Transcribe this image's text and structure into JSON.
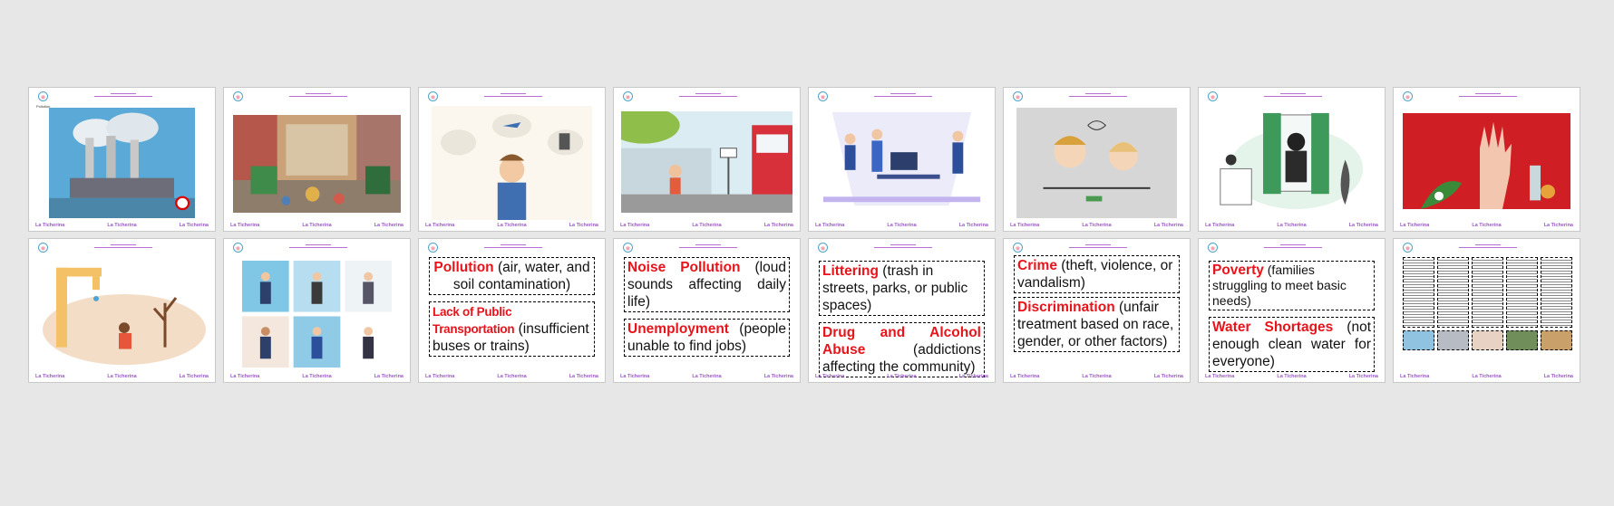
{
  "footer": {
    "brand": "La Ticherina"
  },
  "slides": [
    {
      "type": "image",
      "icon": "factory-pollution-illustration",
      "label": "Pollution"
    },
    {
      "type": "image",
      "icon": "littered-street-illustration"
    },
    {
      "type": "image",
      "icon": "noise-stress-illustration"
    },
    {
      "type": "image",
      "icon": "missed-bus-illustration"
    },
    {
      "type": "image",
      "icon": "office-unemployment-illustration"
    },
    {
      "type": "image",
      "icon": "stressed-people-illustration"
    },
    {
      "type": "image",
      "icon": "burglar-window-illustration"
    },
    {
      "type": "image",
      "icon": "drugs-alcohol-hand-illustration"
    },
    {
      "type": "image",
      "icon": "dry-tap-drought-illustration"
    },
    {
      "type": "image",
      "icon": "discrimination-grid-illustration"
    },
    {
      "type": "text",
      "boxes": [
        {
          "keyword": "Pollution",
          "text": " (air, water, and soil contamination)"
        },
        {
          "keyword": "Lack of Public Transportation",
          "text": " (insufficient buses or trains)"
        }
      ]
    },
    {
      "type": "text",
      "boxes": [
        {
          "keyword": "Noise Pollution",
          "text": " (loud sounds affecting daily life)"
        },
        {
          "keyword": "Unemployment",
          "text": " (people unable to find jobs)"
        }
      ]
    },
    {
      "type": "text",
      "boxes": [
        {
          "keyword": "Littering",
          "text": " (trash in streets, parks, or public spaces)"
        },
        {
          "keyword": "Drug and Alcohol Abuse",
          "text": " (addictions affecting the community)"
        }
      ]
    },
    {
      "type": "text",
      "boxes": [
        {
          "keyword": "Crime",
          "text": " (theft, violence, or vandalism)"
        },
        {
          "keyword": "Discrimination",
          "text": " (unfair treatment based on race, gender, or other factors)"
        }
      ]
    },
    {
      "type": "text",
      "boxes": [
        {
          "keyword": "Poverty",
          "text": " (families struggling to meet basic needs)"
        },
        {
          "keyword": "Water Shortages",
          "text": " (not enough clean water for everyone)"
        }
      ]
    },
    {
      "type": "worksheet",
      "icon": "worksheet-thumbnail"
    }
  ],
  "colors": {
    "keyword": "#e8141b",
    "brand": "#9b59c4",
    "background": "#e7e7e7"
  }
}
